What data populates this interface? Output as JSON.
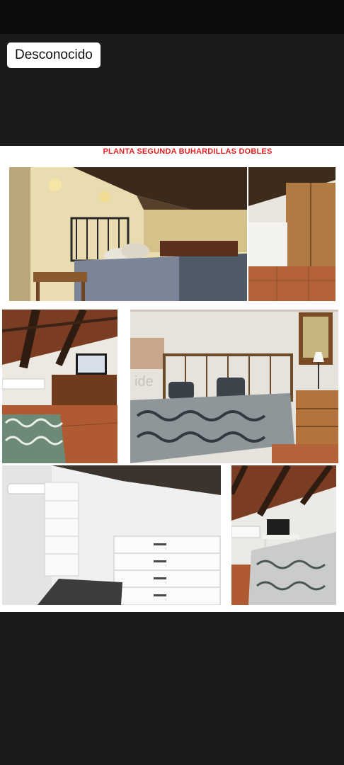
{
  "status_badge": {
    "label": "Desconocido"
  },
  "document": {
    "title": "PLANTA SEGUNDA BUHARDILLAS DOBLES",
    "photos": [
      {
        "name": "bedroom-wall-lamps"
      },
      {
        "name": "wardrobe-corner"
      },
      {
        "name": "attic-tv-dresser"
      },
      {
        "name": "double-bed-nightstand"
      },
      {
        "name": "closet-white-drawers"
      },
      {
        "name": "attic-bed-desk"
      }
    ],
    "watermark": "ide"
  },
  "colors": {
    "title_red": "#e02020",
    "dark_background": "#1b1b1b",
    "badge_background": "#ffffff"
  }
}
